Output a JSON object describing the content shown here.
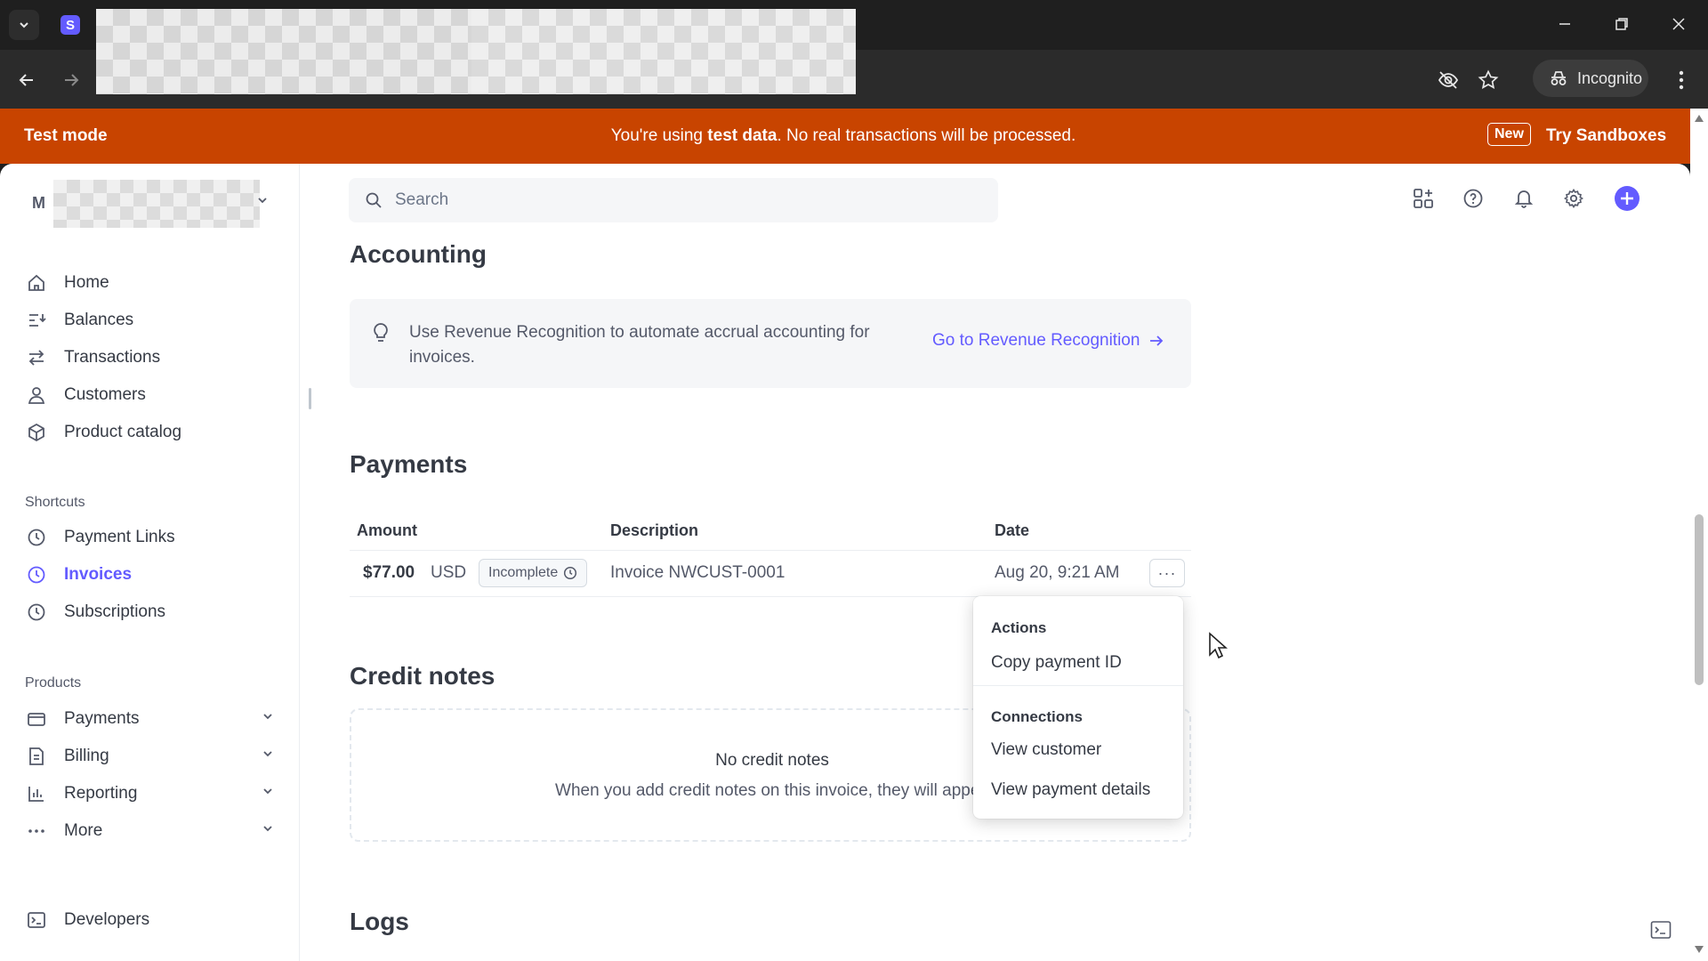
{
  "browser": {
    "tab_favicon_letter": "S",
    "incognito_label": "Incognito"
  },
  "banner": {
    "mode_label": "Test mode",
    "message_prefix": "You're using ",
    "message_bold": "test data",
    "message_suffix": ". No real transactions will be processed.",
    "new_badge": "New",
    "try_label": "Try Sandboxes",
    "color": "#c84400"
  },
  "account": {
    "initial": "M"
  },
  "sidebar": {
    "main_items": [
      {
        "label": "Home",
        "icon": "home-icon"
      },
      {
        "label": "Balances",
        "icon": "balances-icon"
      },
      {
        "label": "Transactions",
        "icon": "transactions-icon"
      },
      {
        "label": "Customers",
        "icon": "customers-icon"
      },
      {
        "label": "Product catalog",
        "icon": "product-catalog-icon"
      }
    ],
    "shortcuts_title": "Shortcuts",
    "shortcuts": [
      {
        "label": "Payment Links",
        "icon": "clock-icon"
      },
      {
        "label": "Invoices",
        "icon": "clock-icon",
        "active": true
      },
      {
        "label": "Subscriptions",
        "icon": "clock-icon"
      }
    ],
    "products_title": "Products",
    "products": [
      {
        "label": "Payments",
        "icon": "payments-icon"
      },
      {
        "label": "Billing",
        "icon": "billing-icon"
      },
      {
        "label": "Reporting",
        "icon": "reporting-icon"
      },
      {
        "label": "More",
        "icon": "more-icon"
      }
    ],
    "developers_label": "Developers"
  },
  "search": {
    "placeholder": "Search"
  },
  "accounting": {
    "title": "Accounting",
    "callout_text": "Use Revenue Recognition to automate accrual accounting for invoices.",
    "link_label": "Go to Revenue Recognition"
  },
  "payments": {
    "title": "Payments",
    "columns": [
      "Amount",
      "Description",
      "Date"
    ],
    "rows": [
      {
        "amount": "$77.00",
        "currency": "USD",
        "status": "Incomplete",
        "description": "Invoice NWCUST-0001",
        "date": "Aug 20, 9:21 AM"
      }
    ],
    "more_label": "···"
  },
  "menu": {
    "actions_title": "Actions",
    "copy_payment_id": "Copy payment ID",
    "connections_title": "Connections",
    "view_customer": "View customer",
    "view_payment_details": "View payment details"
  },
  "credit_notes": {
    "title": "Credit notes",
    "empty_title": "No credit notes",
    "empty_sub": "When you add credit notes on this invoice, they will appea"
  },
  "logs": {
    "title": "Logs"
  },
  "colors": {
    "accent": "#635bff",
    "text": "#353a44"
  }
}
